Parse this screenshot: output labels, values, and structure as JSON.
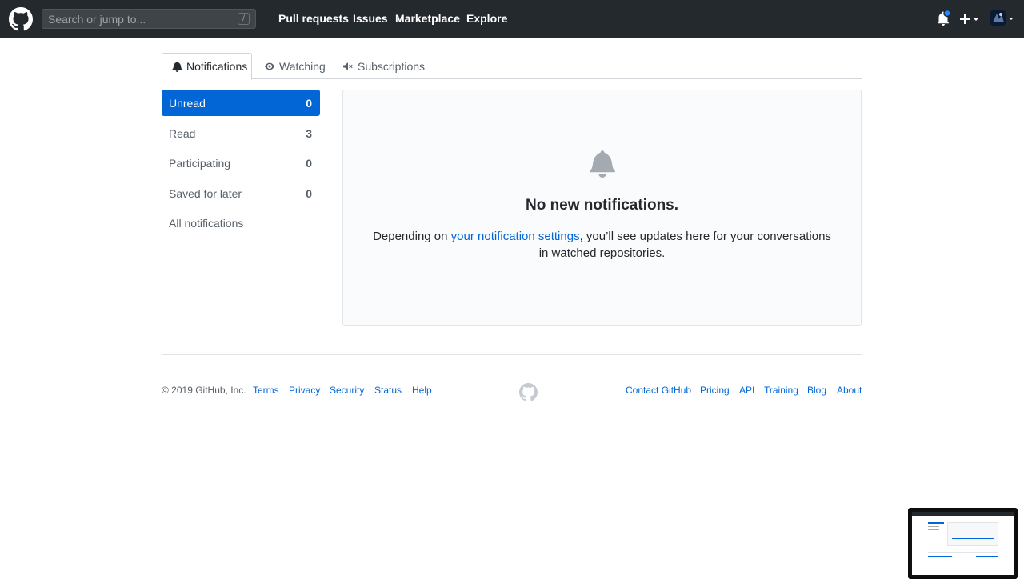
{
  "header": {
    "search_placeholder": "Search or jump to...",
    "search_key": "/",
    "nav": [
      "Pull requests",
      "Issues",
      "Marketplace",
      "Explore"
    ],
    "has_unread_indicator": true
  },
  "tabs": [
    {
      "label": "Notifications",
      "icon": "bell-icon",
      "active": true
    },
    {
      "label": "Watching",
      "icon": "eye-icon",
      "active": false
    },
    {
      "label": "Subscriptions",
      "icon": "megaphone-icon",
      "active": false
    }
  ],
  "sidebar": {
    "items": [
      {
        "label": "Unread",
        "count": "0",
        "selected": true
      },
      {
        "label": "Read",
        "count": "3",
        "selected": false
      },
      {
        "label": "Participating",
        "count": "0",
        "selected": false
      },
      {
        "label": "Saved for later",
        "count": "0",
        "selected": false
      },
      {
        "label": "All notifications",
        "count": "",
        "selected": false
      }
    ]
  },
  "blankslate": {
    "title": "No new notifications.",
    "desc_before": "Depending on ",
    "desc_link": "your notification settings",
    "desc_after": ", you’ll see updates here for your conversations in watched repositories."
  },
  "footer": {
    "copyright": "© 2019 GitHub, Inc.",
    "left_links": [
      "Terms",
      "Privacy",
      "Security",
      "Status",
      "Help"
    ],
    "right_links": [
      "Contact GitHub",
      "Pricing",
      "API",
      "Training",
      "Blog",
      "About"
    ]
  },
  "colors": {
    "header_bg": "#24292e",
    "accent": "#0366d6",
    "indicator": "#2188ff"
  }
}
